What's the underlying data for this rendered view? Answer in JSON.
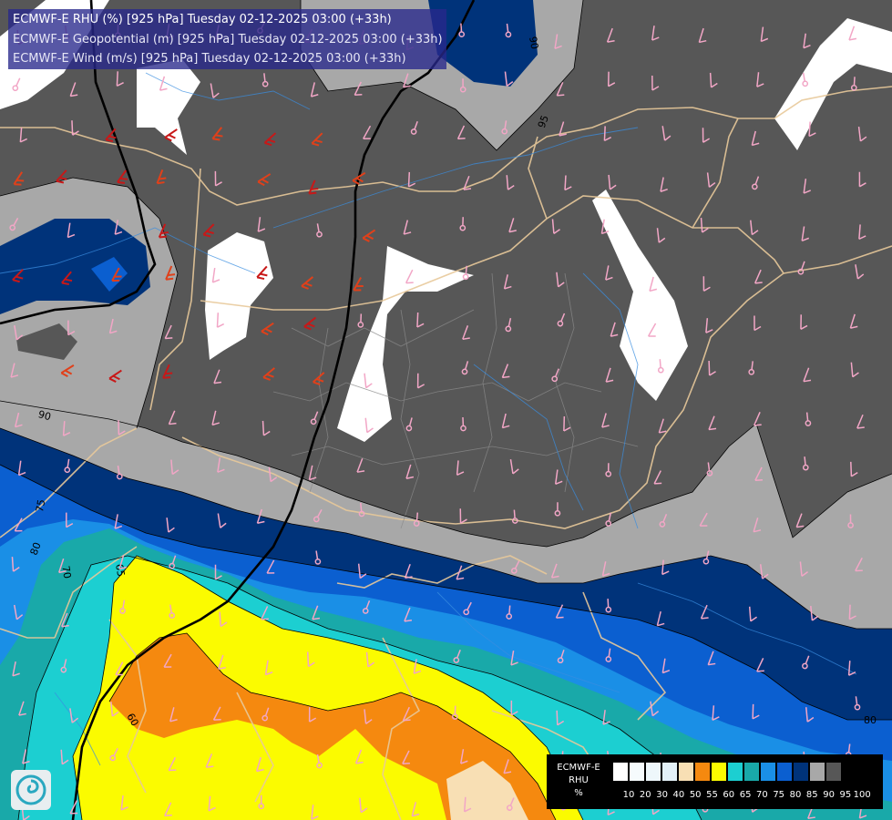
{
  "title": {
    "line1": "ECMWF-E RHU (%) [925 hPa] Tuesday 02-12-2025 03:00 (+33h)",
    "line2": "ECMWF-E Geopotential (m) [925 hPa] Tuesday 02-12-2025 03:00 (+33h)",
    "line3": "ECMWF-E Wind (m/s) [925 hPa] Tuesday 02-12-2025 03:00 (+33h)"
  },
  "legend": {
    "title_lines": [
      "ECMWF-E",
      "RHU",
      "%"
    ],
    "swatch_colors": [
      "#ffffff",
      "#f6fbfd",
      "#eef7fb",
      "#e3f1f8",
      "#f8dfb4",
      "#f5890f",
      "#fbfb00",
      "#1ccfd1",
      "#19a9a9",
      "#1a8fe6",
      "#0b5fd0",
      "#00337a",
      "#a8a8a8",
      "#575757"
    ],
    "tick_labels": [
      "10",
      "20",
      "30",
      "40",
      "50",
      "55",
      "60",
      "65",
      "70",
      "75",
      "80",
      "85",
      "90",
      "95",
      "100"
    ]
  },
  "contour_labels": [
    "60",
    "65",
    "70",
    "75",
    "80",
    "80",
    "85",
    "90",
    "90",
    "95",
    "80"
  ],
  "colors": {
    "rhu_100": "#575757",
    "rhu_95": "#a8a8a8",
    "rhu_90": "#00337a",
    "rhu_85": "#0b5fd0",
    "rhu_80": "#1a8fe6",
    "rhu_75": "#19a9a9",
    "rhu_70": "#1ccfd1",
    "rhu_65": "#fbfb00",
    "rhu_60": "#f5890f",
    "rhu_55": "#f8dfb4",
    "rhu_low": "#ffffff",
    "border": "#e8c99a",
    "wind_calm": "#f2a6c6",
    "wind_strong": "#e0401a"
  },
  "logo_icon": "ecmwf-logo-icon"
}
